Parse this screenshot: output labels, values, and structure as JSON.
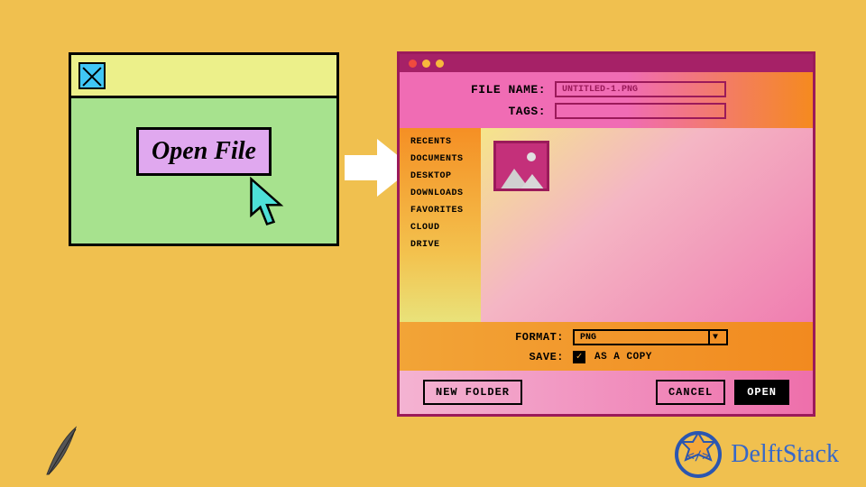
{
  "left": {
    "open_label": "Open File"
  },
  "dialog": {
    "file_name_label": "FILE NAME:",
    "file_name_value": "UNTITLED-1.PNG",
    "tags_label": "TAGS:",
    "tags_value": "",
    "sidebar": [
      "RECENTS",
      "DOCUMENTS",
      "DESKTOP",
      "DOWNLOADS",
      "FAVORITES",
      "CLOUD",
      "DRIVE"
    ],
    "format_label": "FORMAT:",
    "format_value": "PNG",
    "save_label": "SAVE:",
    "save_option": "AS A COPY",
    "footer": {
      "new_folder": "NEW FOLDER",
      "cancel": "CANCEL",
      "open": "OPEN"
    }
  },
  "brand": "DelftStack"
}
